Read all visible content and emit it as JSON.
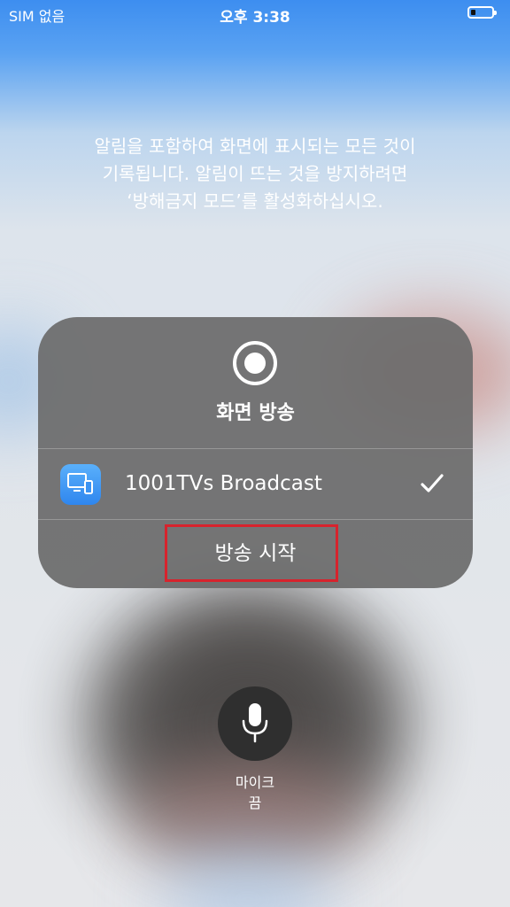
{
  "status_bar": {
    "carrier": "SIM 없음",
    "time": "오후 3:38",
    "battery_level": 0.15
  },
  "notice": {
    "lines": [
      "알림을 포함하여 화면에 표시되는 모든 것이",
      "기록됩니다. 알림이 뜨는 것을 방지하려면",
      "‘방해금지 모드’를 활성화하십시오."
    ]
  },
  "panel": {
    "record_icon": "record-icon",
    "title": "화면 방송",
    "option": {
      "icon": "screen-mirror-app-icon",
      "label": "1001TVs Broadcast",
      "selected": true
    },
    "start_label": "방송 시작"
  },
  "microphone": {
    "icon": "microphone-icon",
    "label_line1": "마이크",
    "label_line2": "끔"
  },
  "colors": {
    "panel_bg": "#6c6c6c",
    "highlight": "#d7232d",
    "status_top": "#3d8ef0",
    "mic_button": "#2f2f2f"
  }
}
